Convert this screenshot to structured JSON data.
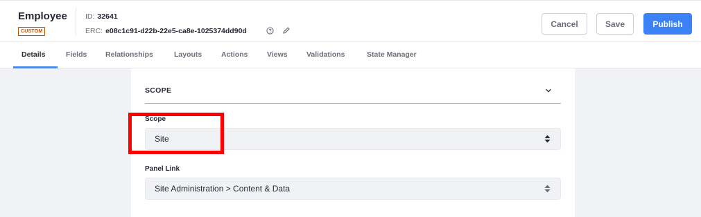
{
  "header": {
    "title": "Employee",
    "badge": "CUSTOM",
    "id_label": "ID:",
    "id_value": "32641",
    "erc_label": "ERC:",
    "erc_value": "e08c1c91-d22b-22e5-ca8e-1025374dd90d",
    "cancel_label": "Cancel",
    "save_label": "Save",
    "publish_label": "Publish"
  },
  "tabs": [
    {
      "label": "Details",
      "active": true
    },
    {
      "label": "Fields"
    },
    {
      "label": "Relationships"
    },
    {
      "label": "Layouts"
    },
    {
      "label": "Actions"
    },
    {
      "label": "Views"
    },
    {
      "label": "Validations"
    },
    {
      "label": "State Manager"
    }
  ],
  "section": {
    "title": "SCOPE",
    "scope_label": "Scope",
    "scope_value": "Site",
    "panel_link_label": "Panel Link",
    "panel_link_value": "Site Administration > Content & Data"
  },
  "icons": {
    "help": "help-circle-icon",
    "edit": "pencil-icon",
    "chevron": "chevron-down-icon",
    "select_arrows": "caret-double-icon"
  },
  "colors": {
    "primary": "#3b82f6",
    "badge": "#b95000",
    "highlight": "#ff0000"
  }
}
